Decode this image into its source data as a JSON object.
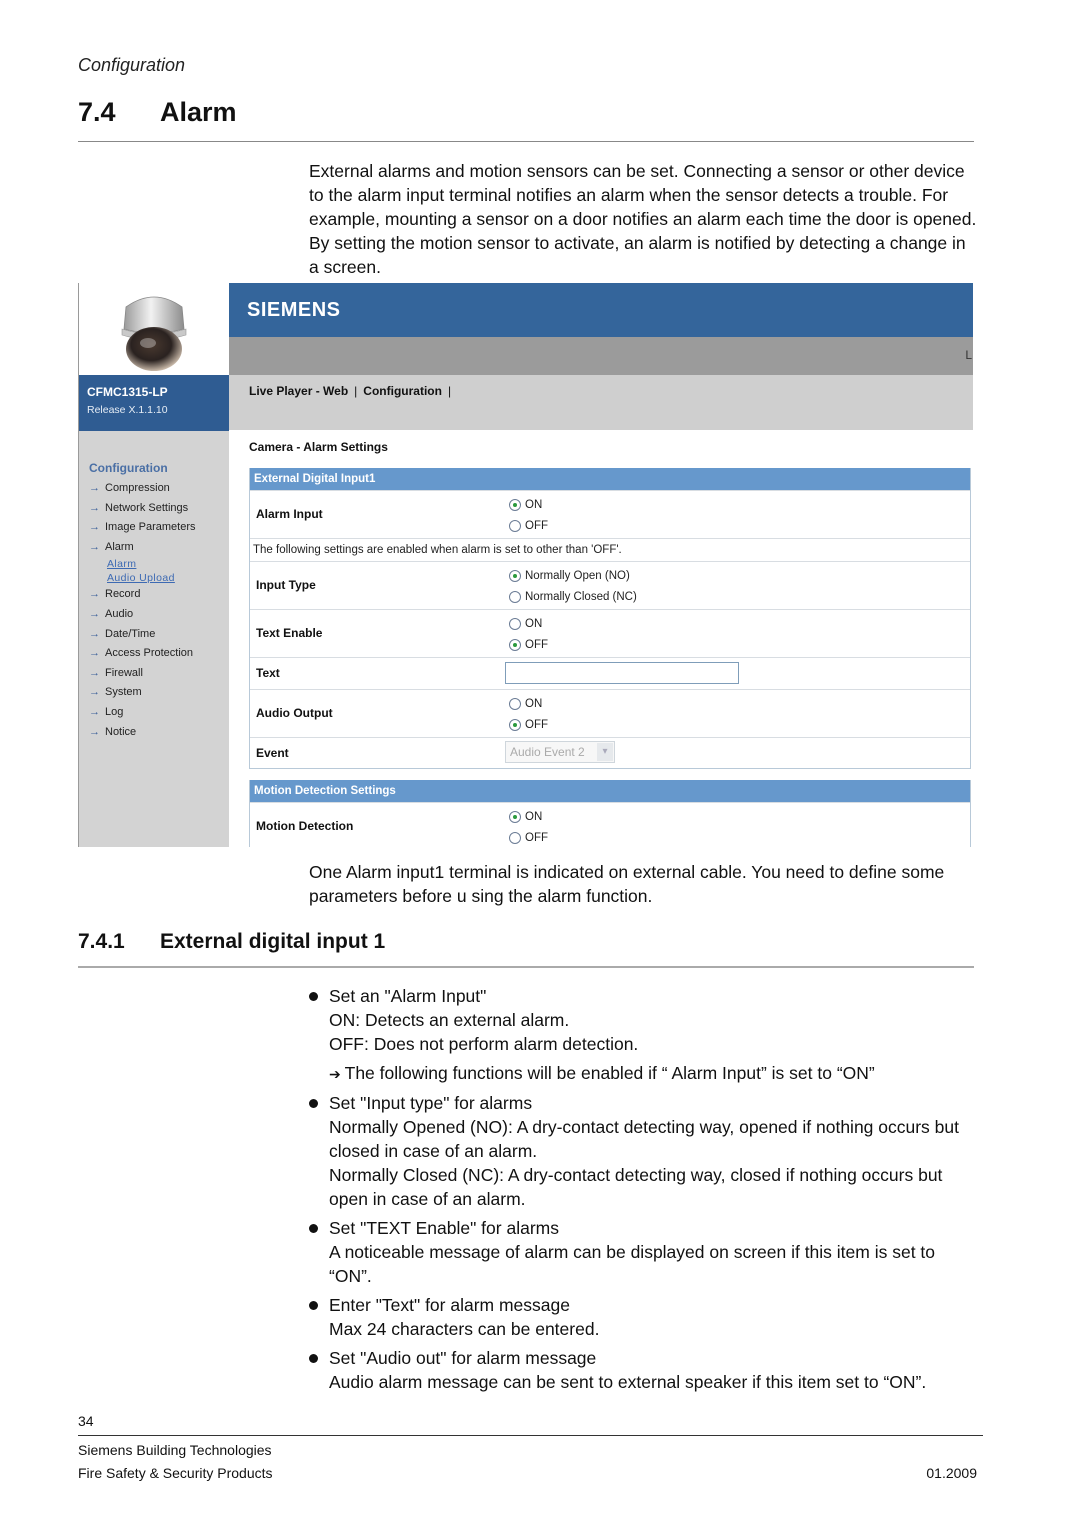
{
  "running_head": "Configuration",
  "section": {
    "number": "7.4",
    "title": "Alarm"
  },
  "intro_text": "External alarms and motion sensors can be set. Connecting a sensor or other device to the alarm input terminal notifies an alarm when the sensor detects a trouble.  For example, mounting a sensor on a door notifies an alarm each time the door is opened. By setting the motion sensor to activate, an alarm is notified by detecting a change in a screen.",
  "screenshot": {
    "brand": "SIEMENS",
    "grey_bar_edge_text": "L",
    "device": {
      "model": "CFMC1315-LP",
      "release": "Release X.1.1.10"
    },
    "top_nav": {
      "items": [
        "Live Player - Web",
        "Configuration"
      ],
      "separator": "|"
    },
    "breadcrumb": "Camera - Alarm Settings",
    "sidebar": {
      "title": "Configuration",
      "items": [
        {
          "label": "Compression"
        },
        {
          "label": "Network Settings"
        },
        {
          "label": "Image Parameters"
        },
        {
          "label": "Alarm",
          "sub": [
            "Alarm",
            "Audio Upload"
          ]
        },
        {
          "label": "Record"
        },
        {
          "label": "Audio"
        },
        {
          "label": "Date/Time"
        },
        {
          "label": "Access Protection"
        },
        {
          "label": "Firewall"
        },
        {
          "label": "System"
        },
        {
          "label": "Log"
        },
        {
          "label": "Notice"
        }
      ]
    },
    "external_input_panel": {
      "title": "External Digital Input1",
      "alarm_input": {
        "label": "Alarm Input",
        "options": [
          "ON",
          "OFF"
        ],
        "selected": "ON"
      },
      "note": "The following settings are enabled when alarm is set to other than 'OFF'.",
      "input_type": {
        "label": "Input Type",
        "options": [
          "Normally Open (NO)",
          "Normally Closed (NC)"
        ],
        "selected": "Normally Open (NO)"
      },
      "text_enable": {
        "label": "Text Enable",
        "options": [
          "ON",
          "OFF"
        ],
        "selected": "OFF"
      },
      "text": {
        "label": "Text",
        "value": ""
      },
      "audio_output": {
        "label": "Audio Output",
        "options": [
          "ON",
          "OFF"
        ],
        "selected": "OFF"
      },
      "event": {
        "label": "Event",
        "value": "Audio Event 2"
      }
    },
    "motion_panel": {
      "title": "Motion Detection Settings",
      "motion_detection": {
        "label": "Motion Detection",
        "options": [
          "ON",
          "OFF"
        ],
        "selected": "ON"
      }
    }
  },
  "after_screenshot_text": "One Alarm input1 terminal is indicated on external cable. You need to define some parameters before u sing the alarm function.",
  "subsection": {
    "number": "7.4.1",
    "title": "External digital input 1"
  },
  "bullets": [
    {
      "head": "Set an \"Alarm Input\"",
      "lines": [
        "ON: Detects an external alarm.",
        "OFF: Does not perform alarm detection."
      ],
      "arrow_note": "The following functions will be enabled if “ Alarm Input” is set to “ON”"
    },
    {
      "head": "Set \"Input type\" for alarms",
      "lines": [
        "Normally Opened (NO): A dry-contact detecting way, opened if nothing occurs but closed in case of an alarm.",
        "Normally Closed (NC): A dry-contact detecting way, closed if nothing occurs but open in case of an alarm."
      ]
    },
    {
      "head": "Set \"TEXT Enable\" for alarms",
      "lines": [
        "A noticeable message of alarm can be displayed on screen if this item is set to “ON”."
      ]
    },
    {
      "head": "Enter \"Text\" for alarm message",
      "lines": [
        "Max 24 characters can be entered."
      ]
    },
    {
      "head": "Set \"Audio out\" for alarm message",
      "lines": [
        "Audio alarm message can be sent to external speaker if this item set to “ON”."
      ]
    }
  ],
  "footer": {
    "page_number": "34",
    "company": "Siemens Building Technologies",
    "division": "Fire Safety & Security Products",
    "date": "01.2009"
  }
}
